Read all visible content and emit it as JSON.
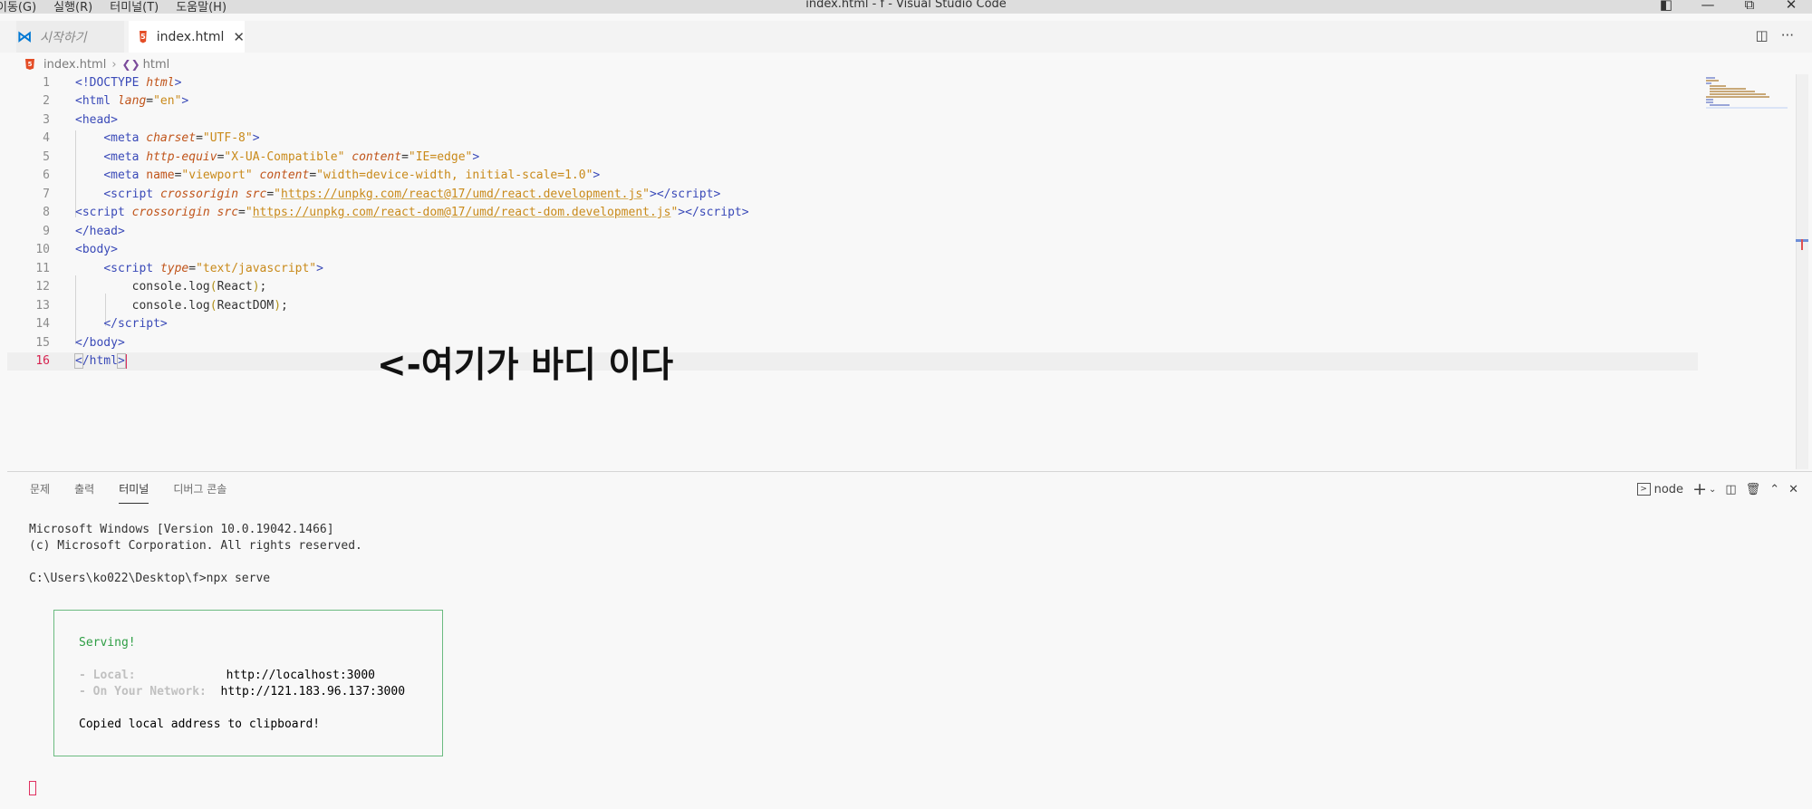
{
  "window": {
    "title": "index.html - f - Visual Studio Code",
    "menu": [
      "이동(G)",
      "실행(R)",
      "터미널(T)",
      "도움말(H)"
    ]
  },
  "tabs": [
    {
      "label": "시작하기",
      "icon": "vscode-logo-icon",
      "active": false
    },
    {
      "label": "index.html",
      "icon": "html5-icon",
      "active": true
    }
  ],
  "breadcrumb": {
    "file": "index.html",
    "symbol": "html"
  },
  "editor": {
    "current_line": 16,
    "line_numbers": [
      "1",
      "2",
      "3",
      "4",
      "5",
      "6",
      "7",
      "8",
      "9",
      "10",
      "11",
      "12",
      "13",
      "14",
      "15",
      "16"
    ],
    "annotation": "<-여기가 바디 이다"
  },
  "panel": {
    "tabs": [
      "문제",
      "출력",
      "터미널",
      "디버그 콘솔"
    ],
    "active_tab": "터미널",
    "shell_label": "node",
    "terminal_lines": [
      "Microsoft Windows [Version 10.0.19042.1466]",
      "(c) Microsoft Corporation. All rights reserved.",
      "",
      "C:\\Users\\ko022\\Desktop\\f>npx serve"
    ],
    "serve": {
      "status": "Serving!",
      "local_label": "- Local:",
      "local_url": "http://localhost:3000",
      "network_label": "- On Your Network:",
      "network_url": "http://121.183.96.137:3000",
      "copied": "Copied local address to clipboard!"
    }
  },
  "colors": {
    "tag": "#3a4ab8",
    "attr": "#c0541a",
    "string": "#c98a1a",
    "accent": "#e03060",
    "serve_green": "#2e9e44"
  }
}
